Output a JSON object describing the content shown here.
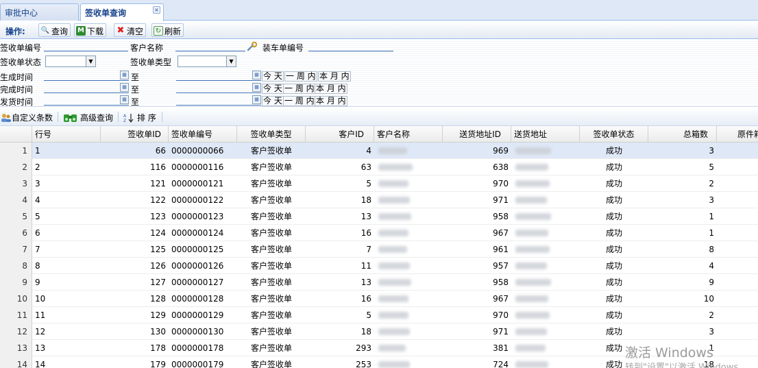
{
  "tabs": [
    {
      "label": "审批中心"
    },
    {
      "label": "签收单查询"
    }
  ],
  "toolbar": {
    "label": "操作:",
    "query": "查询",
    "download": "下载",
    "clear": "清空",
    "refresh": "刷新"
  },
  "form": {
    "receipt_no": "签收单编号",
    "customer_name": "客户名称",
    "load_no": "装车单编号",
    "receipt_status": "签收单状态",
    "receipt_type": "签收单类型",
    "gen_time": "生成时间",
    "done_time": "完成时间",
    "ship_time": "发货时间",
    "to": "至",
    "today": "今 天",
    "week": "一 周 内",
    "month": "本 月 内"
  },
  "grid_toolbar": {
    "custom": "自定义条数",
    "advanced": "高级查询",
    "sort": "排 序"
  },
  "columns": [
    "行号",
    "签收单ID",
    "签收单编号",
    "签收单类型",
    "客户ID",
    "客户名称",
    "送货地址ID",
    "送货地址",
    "签收单状态",
    "总箱数",
    "原件箱"
  ],
  "rows": [
    {
      "n": "1",
      "line": "1",
      "id": "66",
      "no": "0000000066",
      "type": "客户签收单",
      "cid": "4",
      "aid": "969",
      "status": "成功",
      "boxes": "3"
    },
    {
      "n": "2",
      "line": "2",
      "id": "116",
      "no": "0000000116",
      "type": "客户签收单",
      "cid": "63",
      "aid": "638",
      "status": "成功",
      "boxes": "5"
    },
    {
      "n": "3",
      "line": "3",
      "id": "121",
      "no": "0000000121",
      "type": "客户签收单",
      "cid": "5",
      "aid": "970",
      "status": "成功",
      "boxes": "2"
    },
    {
      "n": "4",
      "line": "4",
      "id": "122",
      "no": "0000000122",
      "type": "客户签收单",
      "cid": "18",
      "aid": "971",
      "status": "成功",
      "boxes": "3"
    },
    {
      "n": "5",
      "line": "5",
      "id": "123",
      "no": "0000000123",
      "type": "客户签收单",
      "cid": "13",
      "aid": "958",
      "status": "成功",
      "boxes": "1"
    },
    {
      "n": "6",
      "line": "6",
      "id": "124",
      "no": "0000000124",
      "type": "客户签收单",
      "cid": "16",
      "aid": "967",
      "status": "成功",
      "boxes": "1"
    },
    {
      "n": "7",
      "line": "7",
      "id": "125",
      "no": "0000000125",
      "type": "客户签收单",
      "cid": "7",
      "aid": "961",
      "status": "成功",
      "boxes": "8"
    },
    {
      "n": "8",
      "line": "8",
      "id": "126",
      "no": "0000000126",
      "type": "客户签收单",
      "cid": "11",
      "aid": "957",
      "status": "成功",
      "boxes": "4"
    },
    {
      "n": "9",
      "line": "9",
      "id": "127",
      "no": "0000000127",
      "type": "客户签收单",
      "cid": "13",
      "aid": "958",
      "status": "成功",
      "boxes": "9"
    },
    {
      "n": "10",
      "line": "10",
      "id": "128",
      "no": "0000000128",
      "type": "客户签收单",
      "cid": "16",
      "aid": "967",
      "status": "成功",
      "boxes": "10"
    },
    {
      "n": "11",
      "line": "11",
      "id": "129",
      "no": "0000000129",
      "type": "客户签收单",
      "cid": "5",
      "aid": "970",
      "status": "成功",
      "boxes": "2"
    },
    {
      "n": "12",
      "line": "12",
      "id": "130",
      "no": "0000000130",
      "type": "客户签收单",
      "cid": "18",
      "aid": "971",
      "status": "成功",
      "boxes": "3"
    },
    {
      "n": "13",
      "line": "13",
      "id": "178",
      "no": "0000000178",
      "type": "客户签收单",
      "cid": "293",
      "aid": "381",
      "status": "成功",
      "boxes": "1"
    },
    {
      "n": "14",
      "line": "14",
      "id": "179",
      "no": "0000000179",
      "type": "客户签收单",
      "cid": "253",
      "aid": "724",
      "status": "成功",
      "boxes": "18"
    }
  ],
  "watermark": {
    "line1": "激活 Windows",
    "line2": "转到\"设置\"以激活 Windows。"
  }
}
